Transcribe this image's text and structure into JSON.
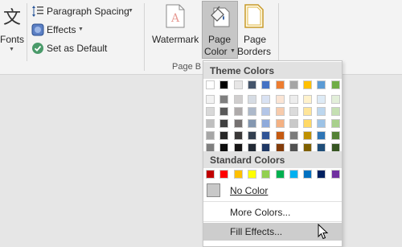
{
  "ribbon": {
    "fonts_label": "Fonts",
    "fonts_glyph": "文",
    "paragraph_spacing_label": "Paragraph Spacing",
    "effects_label": "Effects",
    "set_default_label": "Set as Default",
    "watermark_label": "Watermark",
    "page_color_line1": "Page",
    "page_color_line2": "Color",
    "page_borders_line1": "Page",
    "page_borders_line2": "Borders",
    "group_label": "Page B"
  },
  "menu": {
    "theme_header": "Theme Colors",
    "standard_header": "Standard Colors",
    "no_color": "No Color",
    "more_colors": "More Colors...",
    "fill_effects": "Fill Effects..."
  },
  "theme_colors": [
    [
      "#ffffff",
      "#f2f2f2",
      "#d9d9d9",
      "#bfbfbf",
      "#a6a6a6",
      "#7f7f7f"
    ],
    [
      "#000000",
      "#7f7f7f",
      "#595959",
      "#404040",
      "#262626",
      "#0d0d0d"
    ],
    [
      "#e7e6e6",
      "#d0cece",
      "#aeaaaa",
      "#757171",
      "#3a3838",
      "#171616"
    ],
    [
      "#44546a",
      "#d6dce4",
      "#adb9ca",
      "#8497b0",
      "#323f4f",
      "#222a35"
    ],
    [
      "#4472c4",
      "#d9e2f3",
      "#b4c6e7",
      "#8eaadb",
      "#2f5496",
      "#1f3864"
    ],
    [
      "#ed7d31",
      "#fbe5d5",
      "#f7cbac",
      "#f4b183",
      "#c55a11",
      "#833c0b"
    ],
    [
      "#a5a5a5",
      "#ededed",
      "#dbdbdb",
      "#c9c9c9",
      "#7b7b7b",
      "#525252"
    ],
    [
      "#ffc000",
      "#fff2cc",
      "#fee599",
      "#ffd965",
      "#bf9000",
      "#7f6000"
    ],
    [
      "#5b9bd5",
      "#deebf6",
      "#bdd7ee",
      "#9dc3e6",
      "#2e75b5",
      "#1f4e79"
    ],
    [
      "#70ad47",
      "#e2efd9",
      "#c5e0b3",
      "#a8d08d",
      "#538135",
      "#375623"
    ]
  ],
  "standard_colors": [
    "#c00000",
    "#ff0000",
    "#ffc000",
    "#ffff00",
    "#92d050",
    "#00b050",
    "#00b0f0",
    "#0070c0",
    "#002060",
    "#7030a0"
  ],
  "accent": "#c6c6c6",
  "hover_highlight": "#cdcdcd"
}
